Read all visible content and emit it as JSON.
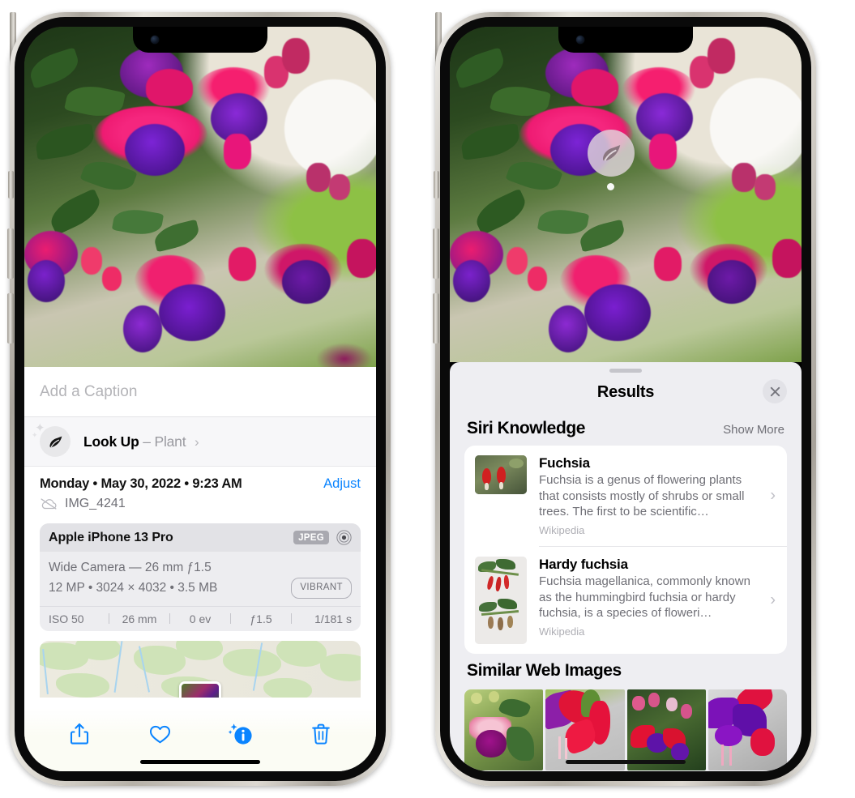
{
  "left_phone": {
    "photo": {
      "alt_name": "fuchsia-flowers-photo"
    },
    "caption_placeholder": "Add a Caption",
    "lookup": {
      "icon": "leaf-icon",
      "label": "Look Up",
      "dash": "–",
      "subject": "Plant",
      "chevron": "›"
    },
    "metadata": {
      "date_line": "Monday • May 30, 2022 • 9:23 AM",
      "adjust_label": "Adjust",
      "cloud_icon": "cloud-slash-icon",
      "filename": "IMG_4241"
    },
    "camera_card": {
      "model": "Apple iPhone 13 Pro",
      "format_badge": "JPEG",
      "raw_icon": "raw-circle-icon",
      "lens_line": "Wide Camera — 26 mm ƒ1.5",
      "specs_line": "12 MP • 3024 × 4032 • 3.5 MB",
      "style_badge": "VIBRANT",
      "exif": [
        "ISO 50",
        "26 mm",
        "0 ev",
        "ƒ1.5",
        "1/181 s"
      ]
    },
    "map": {
      "name": "location-map-thumbnail"
    },
    "toolbar": [
      {
        "name": "share-icon",
        "label": "Share"
      },
      {
        "name": "heart-icon",
        "label": "Favorite"
      },
      {
        "name": "info-sparkle-icon",
        "label": "Info"
      },
      {
        "name": "trash-icon",
        "label": "Delete"
      }
    ]
  },
  "right_phone": {
    "photo_badge": {
      "icon": "leaf-icon",
      "name": "visual-lookup-leaf-badge"
    },
    "sheet": {
      "title": "Results",
      "close_icon": "close-icon",
      "sections": [
        {
          "heading": "Siri Knowledge",
          "action": "Show More",
          "cards": [
            {
              "title": "Fuchsia",
              "description": "Fuchsia is a genus of flowering plants that consists mostly of shrubs or small trees. The first to be scientific…",
              "source": "Wikipedia",
              "thumb": "fuchsia-thumbnail",
              "chevron": "›"
            },
            {
              "title": "Hardy fuchsia",
              "description": "Fuchsia magellanica, commonly known as the hummingbird fuchsia or hardy fuchsia, is a species of floweri…",
              "source": "Wikipedia",
              "thumb": "hardy-fuchsia-thumbnail",
              "chevron": "›"
            }
          ]
        },
        {
          "heading": "Similar Web Images",
          "images": [
            {
              "name": "similar-image-1"
            },
            {
              "name": "similar-image-2"
            },
            {
              "name": "similar-image-3"
            },
            {
              "name": "similar-image-4"
            }
          ]
        }
      ]
    }
  },
  "colors": {
    "accent_blue": "#0a84ff",
    "sheet_bg": "#eeeef2",
    "card_bg": "#ffffff",
    "secondary_text": "#6f6f76",
    "tertiary_text": "#aeaeb4"
  }
}
